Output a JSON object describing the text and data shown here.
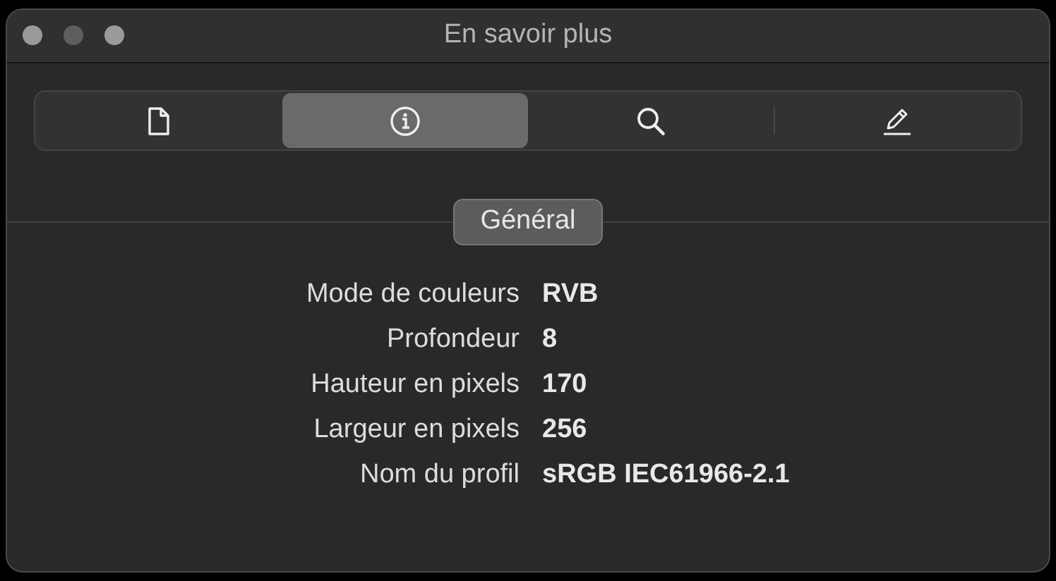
{
  "window": {
    "title": "En savoir plus"
  },
  "tabs": [
    {
      "kind": "document",
      "selected": false
    },
    {
      "kind": "info",
      "selected": true
    },
    {
      "kind": "search",
      "selected": false
    },
    {
      "kind": "annotate",
      "selected": false
    }
  ],
  "section": {
    "title": "Général"
  },
  "properties": [
    {
      "label": "Mode de couleurs",
      "value": "RVB"
    },
    {
      "label": "Profondeur",
      "value": "8"
    },
    {
      "label": "Hauteur en pixels",
      "value": "170"
    },
    {
      "label": "Largeur en pixels",
      "value": "256"
    },
    {
      "label": "Nom du profil",
      "value": "sRGB IEC61966-2.1"
    }
  ]
}
